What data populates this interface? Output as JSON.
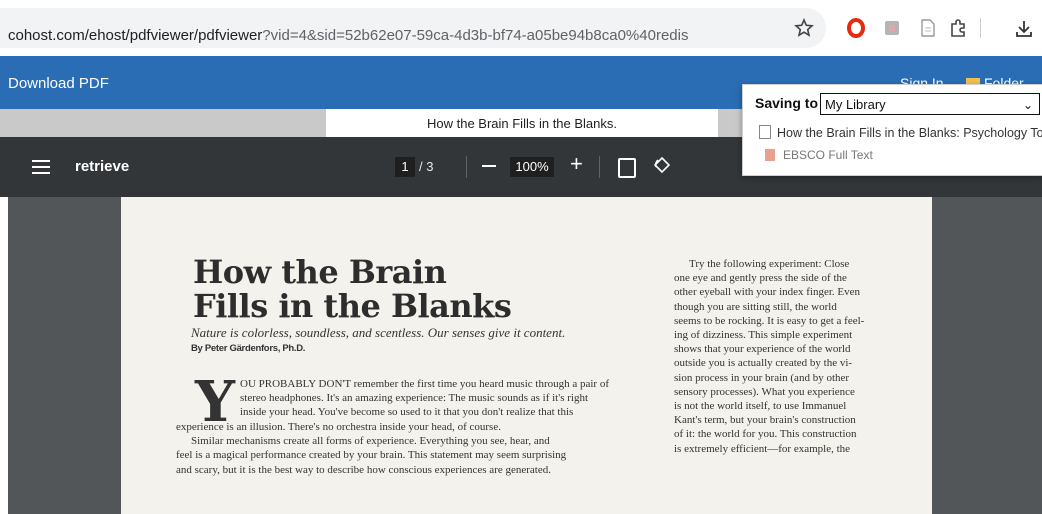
{
  "browser": {
    "url_main": "cohost.com/ehost/pdfviewer/pdfviewer",
    "url_query": "?vid=4&sid=52b62e07-59ca-4d3b-bf74-a05be94b8ca0%40redis"
  },
  "ebsco": {
    "download_label": "Download PDF",
    "signin_label": "Sign In",
    "folder_label": "Folder",
    "title_tab": "How the Brain Fills in the Blanks."
  },
  "pdf_toolbar": {
    "file_name": "retrieve",
    "current_page": "1",
    "page_total": "/ 3",
    "zoom": "100%"
  },
  "article": {
    "headline_line1": "How the Brain",
    "headline_line2": "Fills in the Blanks",
    "subhead": "Nature is colorless, soundless, and scentless. Our senses give it content.",
    "byline": "By Peter Gärdenfors, Ph.D.",
    "dropcap": "Y",
    "col1_lines": [
      "OU PROBABLY DON'T remember the first time you heard music through a pair of",
      "stereo headphones. It's an amazing experience: The music sounds as if it's right",
      "inside your head. You've become so used to it that you don't realize that this"
    ],
    "col1_full_lines": [
      "experience is an illusion. There's no orchestra inside your head, of course.",
      "Similar mechanisms create all forms of experience. Everything you see, hear, and",
      "feel is a magical performance created by your brain. This statement may seem surprising",
      "and scary, but it is the best way to describe how conscious experiences are generated."
    ],
    "col2_lines": [
      "Try the following experiment: Close",
      "one eye and gently press the side of the",
      "other eyeball with your index finger. Even",
      "though you are sitting still, the world",
      "seems to be rocking. It is easy to get a feel-",
      "ing of dizziness. This simple experiment",
      "shows that your experience of the world",
      "outside you is actually created by the vi-",
      "sion process in your brain (and by other",
      "sensory processes). What you experience",
      "is not the world itself, to use Immanuel",
      "Kant's term, but your brain's construction",
      "of it: the world for you. This construction",
      "is extremely efficient—for example, the"
    ]
  },
  "saving_popup": {
    "label": "Saving to",
    "selected": "My Library",
    "item_title": "How the Brain Fills in the Blanks: Psychology Tod",
    "item_sub": "EBSCO Full Text"
  },
  "colors": {
    "ebsco_blue": "#2a6db5",
    "pdf_toolbar": "#323639",
    "viewer_bg": "#525659"
  }
}
